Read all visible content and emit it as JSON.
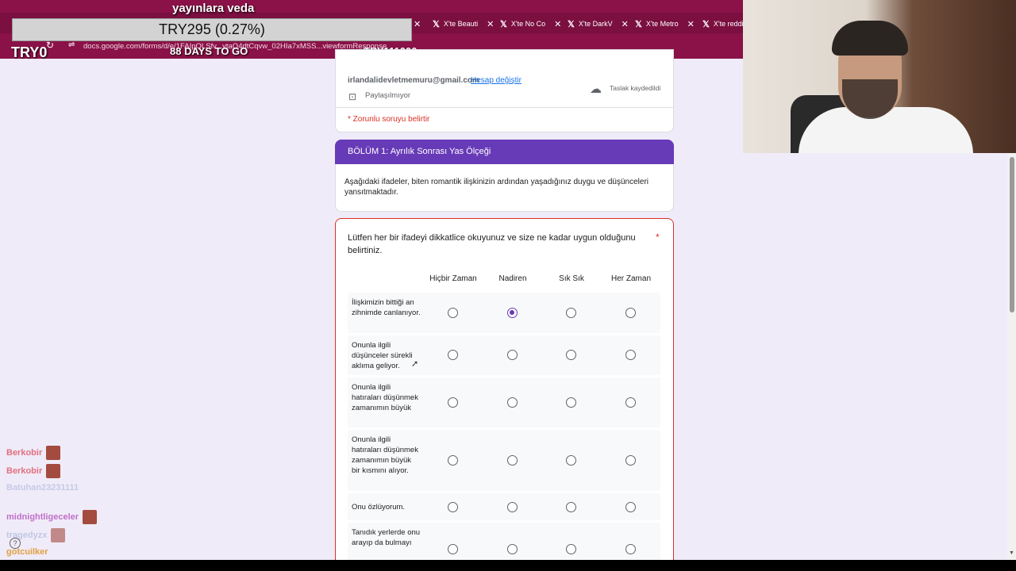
{
  "overlay": {
    "title": "yayınlara veda",
    "ticker": "TRY295 (0.27%)",
    "balance": "TRY0",
    "days": "88 DAYS TO GO",
    "goal": "TRY111000"
  },
  "browser": {
    "url": "docs.google.com/forms/d/e/1FAIpQLSfv...ytaO4dtCqvw_02HIa7xMSS...viewformResponse",
    "tabs": [
      {
        "label": "X'te Beauti"
      },
      {
        "label": "X'te No Co"
      },
      {
        "label": "X'te DarkV"
      },
      {
        "label": "X'te Metro"
      },
      {
        "label": "X'te reddi"
      }
    ]
  },
  "account": {
    "email": "irlandalidevletmemuru@gmail.com",
    "switch_label": "Hesap değiştir",
    "share_status": "Paylaşılmıyor",
    "draft_status": "Taslak kaydedildi",
    "required_note": "* Zorunlu soruyu belirtir"
  },
  "section": {
    "title": "BÖLÜM 1: Ayrılık Sonrası Yas Ölçeği",
    "description": "Aşağıdaki ifadeler, biten romantik ilişkinizin ardından yaşadığınız duygu ve düşünceleri yansıtmaktadır."
  },
  "question": {
    "text": "Lütfen her bir ifadeyi dikkatlice okuyunuz ve size ne kadar uygun olduğunu belirtiniz.",
    "required_mark": "*",
    "columns": [
      "Hiçbir Zaman",
      "Nadiren",
      "Sık Sık",
      "Her Zaman"
    ],
    "rows": [
      {
        "label": "İlişkimizin bittiği an zihnimde canlanıyor.",
        "selected": 1
      },
      {
        "label": "Onunla ilgili düşünceler sürekli aklıma geliyor.",
        "selected": null
      },
      {
        "label": "Onunla ilgili hatıraları düşünmek zamanımın büyük",
        "selected": null
      },
      {
        "label": "Onunla ilgili hatıraları düşünmek zamanımın büyük bir kısmını alıyor.",
        "selected": null
      },
      {
        "label": "Onu özlüyorum.",
        "selected": null
      },
      {
        "label": "Tanıdık yerlerde onu arayıp da bulmayı",
        "selected": null
      }
    ]
  },
  "chat": [
    {
      "user": "Berkobir",
      "color": "#e07080",
      "message": ""
    },
    {
      "user": "Berkobir",
      "color": "#e07080",
      "message": ""
    },
    {
      "user": "Batuhan23231111",
      "color": "#c9d3e8",
      "message": ""
    },
    {
      "user": "midnightligeceler",
      "color": "#c070c8",
      "message": ""
    },
    {
      "user": "tragedyzx",
      "color": "#c9d3e8",
      "message": ""
    },
    {
      "user": "gotcuilker",
      "color": "#e0a040",
      "message": ""
    }
  ],
  "colors": {
    "accent": "#673ab7",
    "required": "#d93025",
    "chrome": "#8a1248"
  }
}
